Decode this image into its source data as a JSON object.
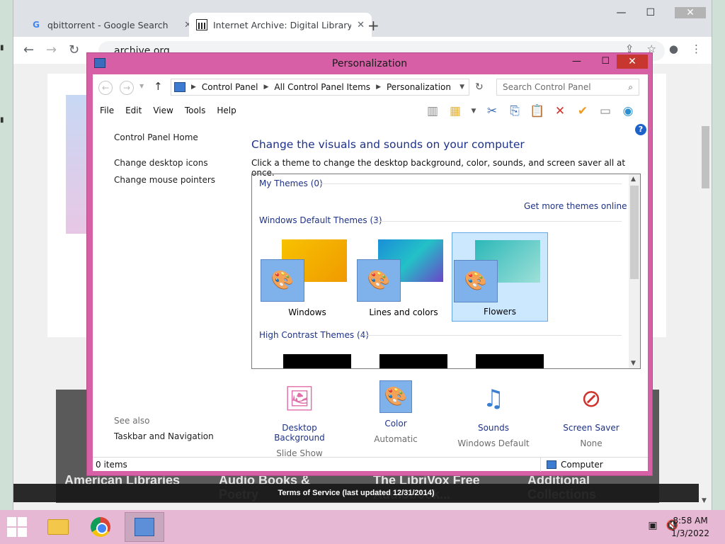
{
  "browser": {
    "tabs": [
      {
        "title": "qbittorrent - Google Search",
        "active": false
      },
      {
        "title": "Internet Archive: Digital Library o",
        "active": true
      }
    ],
    "new_tab": "+",
    "url": "archive.org",
    "page": {
      "collections": [
        "American Libraries",
        "Audio Books & Poetry",
        "The LibriVox Free Audiobook...",
        "Additional Collections"
      ],
      "tos_text": "Terms of Service (last updated 12/31/2014)"
    }
  },
  "window": {
    "title": "Personalization",
    "breadcrumb": [
      "Control Panel",
      "All Control Panel Items",
      "Personalization"
    ],
    "search_placeholder": "Search Control Panel",
    "menu": [
      "File",
      "Edit",
      "View",
      "Tools",
      "Help"
    ],
    "sidebar": {
      "home": "Control Panel Home",
      "links": [
        "Change desktop icons",
        "Change mouse pointers"
      ],
      "see_also": "See also",
      "see_also_links": [
        "Taskbar and Navigation"
      ]
    },
    "main": {
      "heading": "Change the visuals and sounds on your computer",
      "subheading": "Click a theme to change the desktop background, color, sounds, and screen saver all at once.",
      "groups": {
        "my_themes": "My Themes (0)",
        "get_more": "Get more themes online",
        "default_themes": "Windows Default Themes (3)",
        "high_contrast": "High Contrast Themes (4)"
      },
      "themes": [
        {
          "name": "Windows",
          "selected": false
        },
        {
          "name": "Lines and colors",
          "selected": false
        },
        {
          "name": "Flowers",
          "selected": true
        }
      ]
    },
    "bottom": [
      {
        "title": "Desktop Background",
        "value": "Slide Show",
        "icon": "desktop-background-icon"
      },
      {
        "title": "Color",
        "value": "Automatic",
        "icon": "color-palette-icon"
      },
      {
        "title": "Sounds",
        "value": "Windows Default",
        "icon": "sounds-icon"
      },
      {
        "title": "Screen Saver",
        "value": "None",
        "icon": "screen-saver-icon"
      }
    ],
    "status": {
      "items": "0 items",
      "location": "Computer"
    }
  },
  "taskbar": {
    "time": "8:58 AM",
    "date": "1/3/2022"
  },
  "colors": {
    "window_frame": "#d75fa6",
    "taskbar": "#e6b8d3",
    "link_blue": "#1e3287"
  }
}
